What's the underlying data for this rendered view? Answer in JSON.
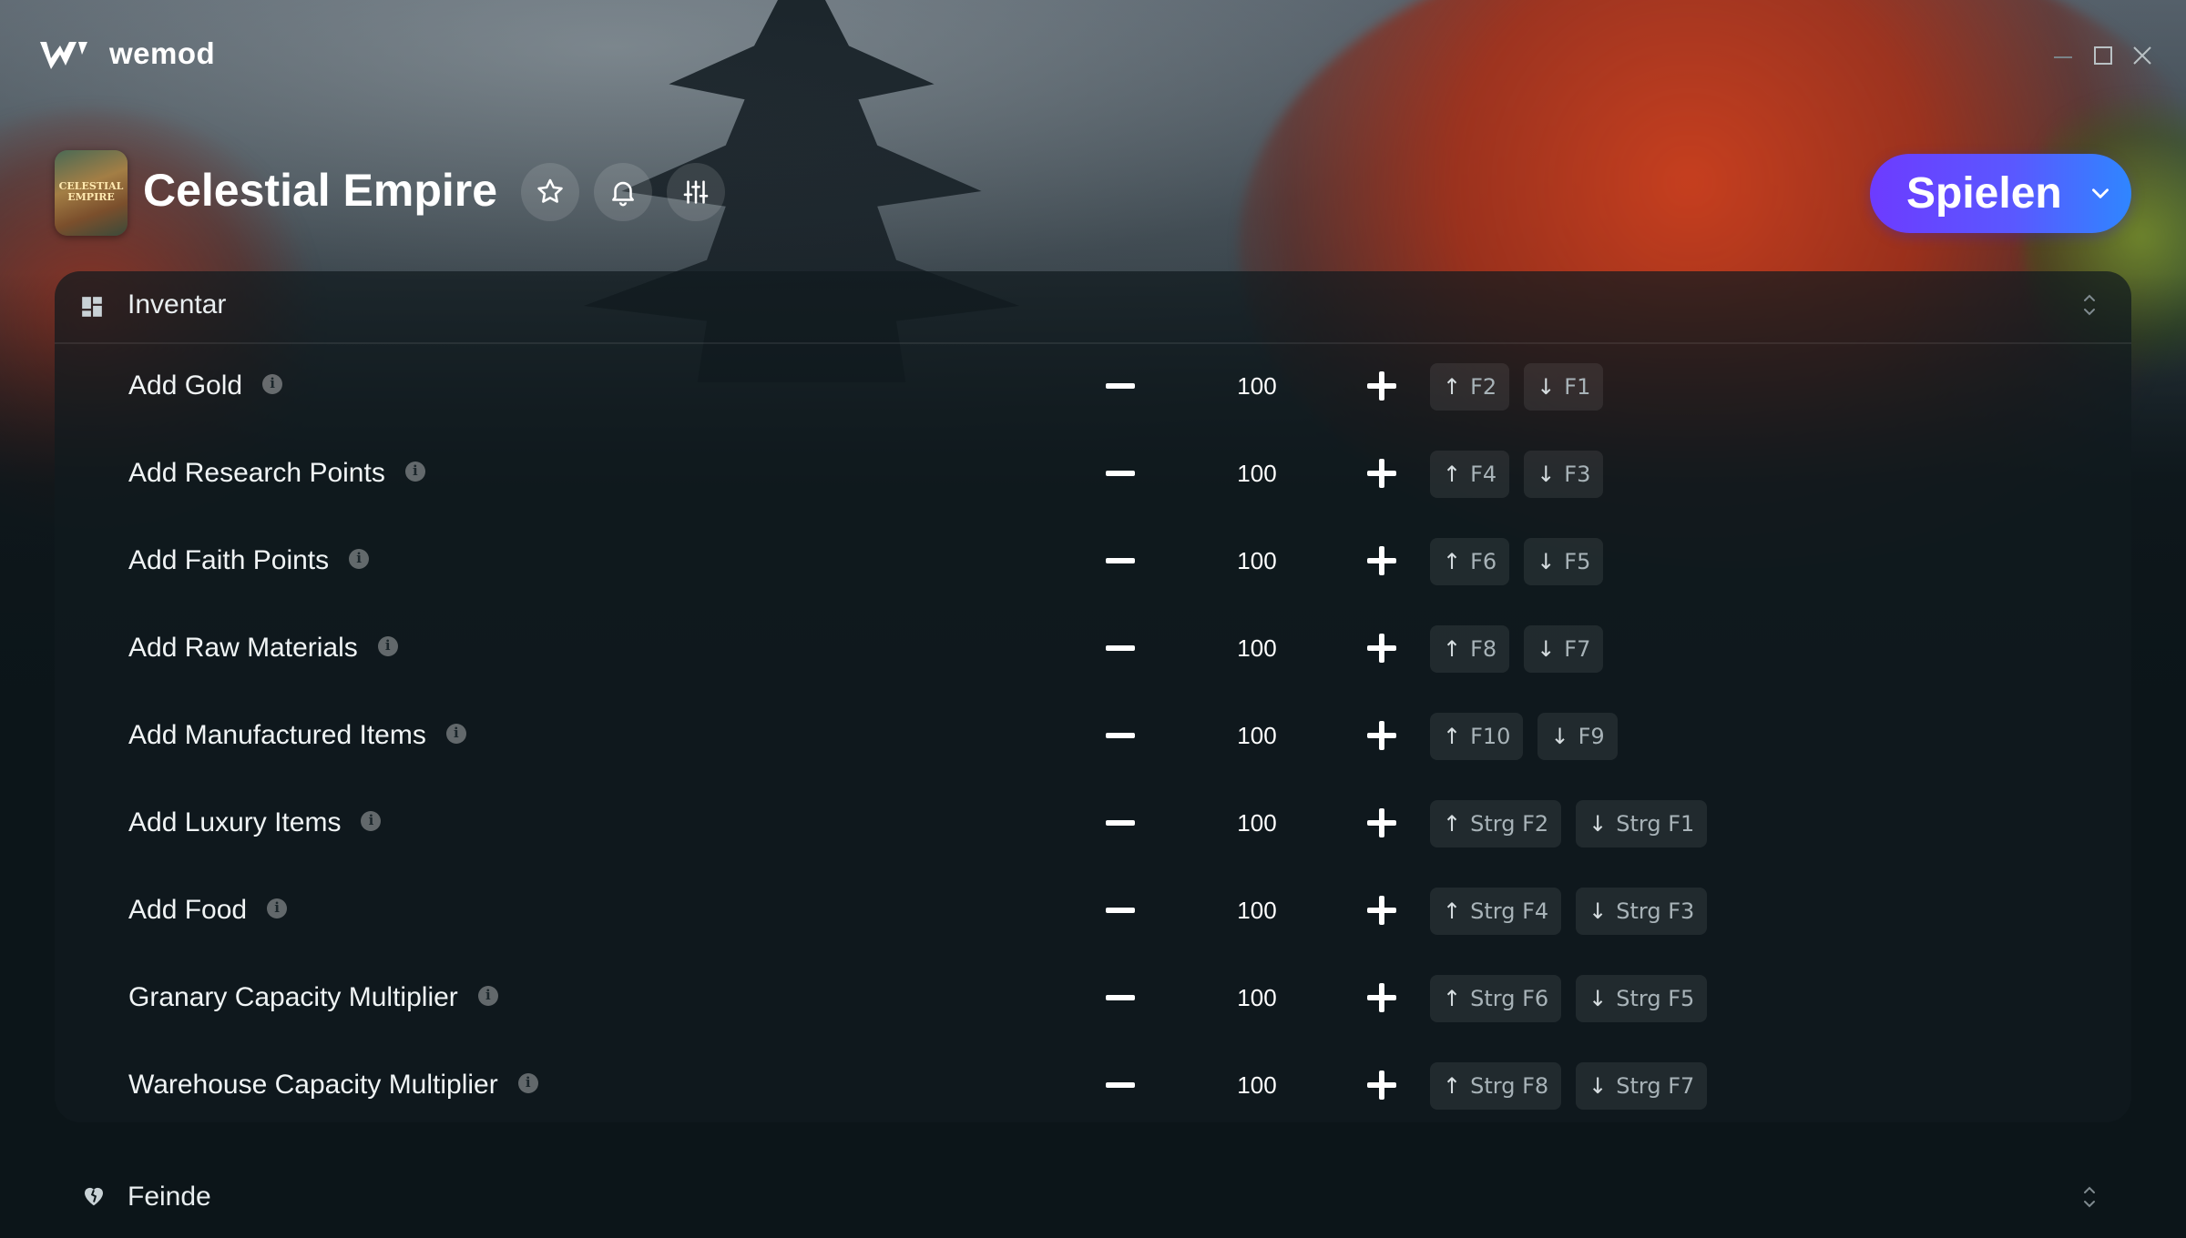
{
  "app": {
    "brand": "wemod"
  },
  "window_controls": {
    "minimize": "minimize",
    "maximize": "maximize",
    "close": "close"
  },
  "game": {
    "title": "Celestial Empire",
    "thumbnail_text": "CELESTIAL EMPIRE",
    "play_label": "Spielen"
  },
  "sections": [
    {
      "label": "Inventar",
      "icon": "inventory-grid-icon",
      "rows": [
        {
          "name": "Add Gold",
          "value": "100",
          "inc_key": "F2",
          "dec_key": "F1"
        },
        {
          "name": "Add Research Points",
          "value": "100",
          "inc_key": "F4",
          "dec_key": "F3"
        },
        {
          "name": "Add Faith Points",
          "value": "100",
          "inc_key": "F6",
          "dec_key": "F5"
        },
        {
          "name": "Add Raw Materials",
          "value": "100",
          "inc_key": "F8",
          "dec_key": "F7"
        },
        {
          "name": "Add Manufactured Items",
          "value": "100",
          "inc_key": "F10",
          "dec_key": "F9"
        },
        {
          "name": "Add Luxury Items",
          "value": "100",
          "inc_key": "Strg F2",
          "dec_key": "Strg F1"
        },
        {
          "name": "Add Food",
          "value": "100",
          "inc_key": "Strg F4",
          "dec_key": "Strg F3"
        },
        {
          "name": "Granary Capacity Multiplier",
          "value": "100",
          "inc_key": "Strg F6",
          "dec_key": "Strg F5"
        },
        {
          "name": "Warehouse Capacity Multiplier",
          "value": "100",
          "inc_key": "Strg F8",
          "dec_key": "Strg F7"
        }
      ]
    },
    {
      "label": "Feinde",
      "icon": "broken-heart-icon",
      "rows": []
    }
  ],
  "arrows": {
    "up": "↑",
    "down": "↓"
  },
  "colors": {
    "play_gradient_start": "#6d3bff",
    "play_gradient_end": "#2f86ff",
    "background": "#0c1519"
  }
}
